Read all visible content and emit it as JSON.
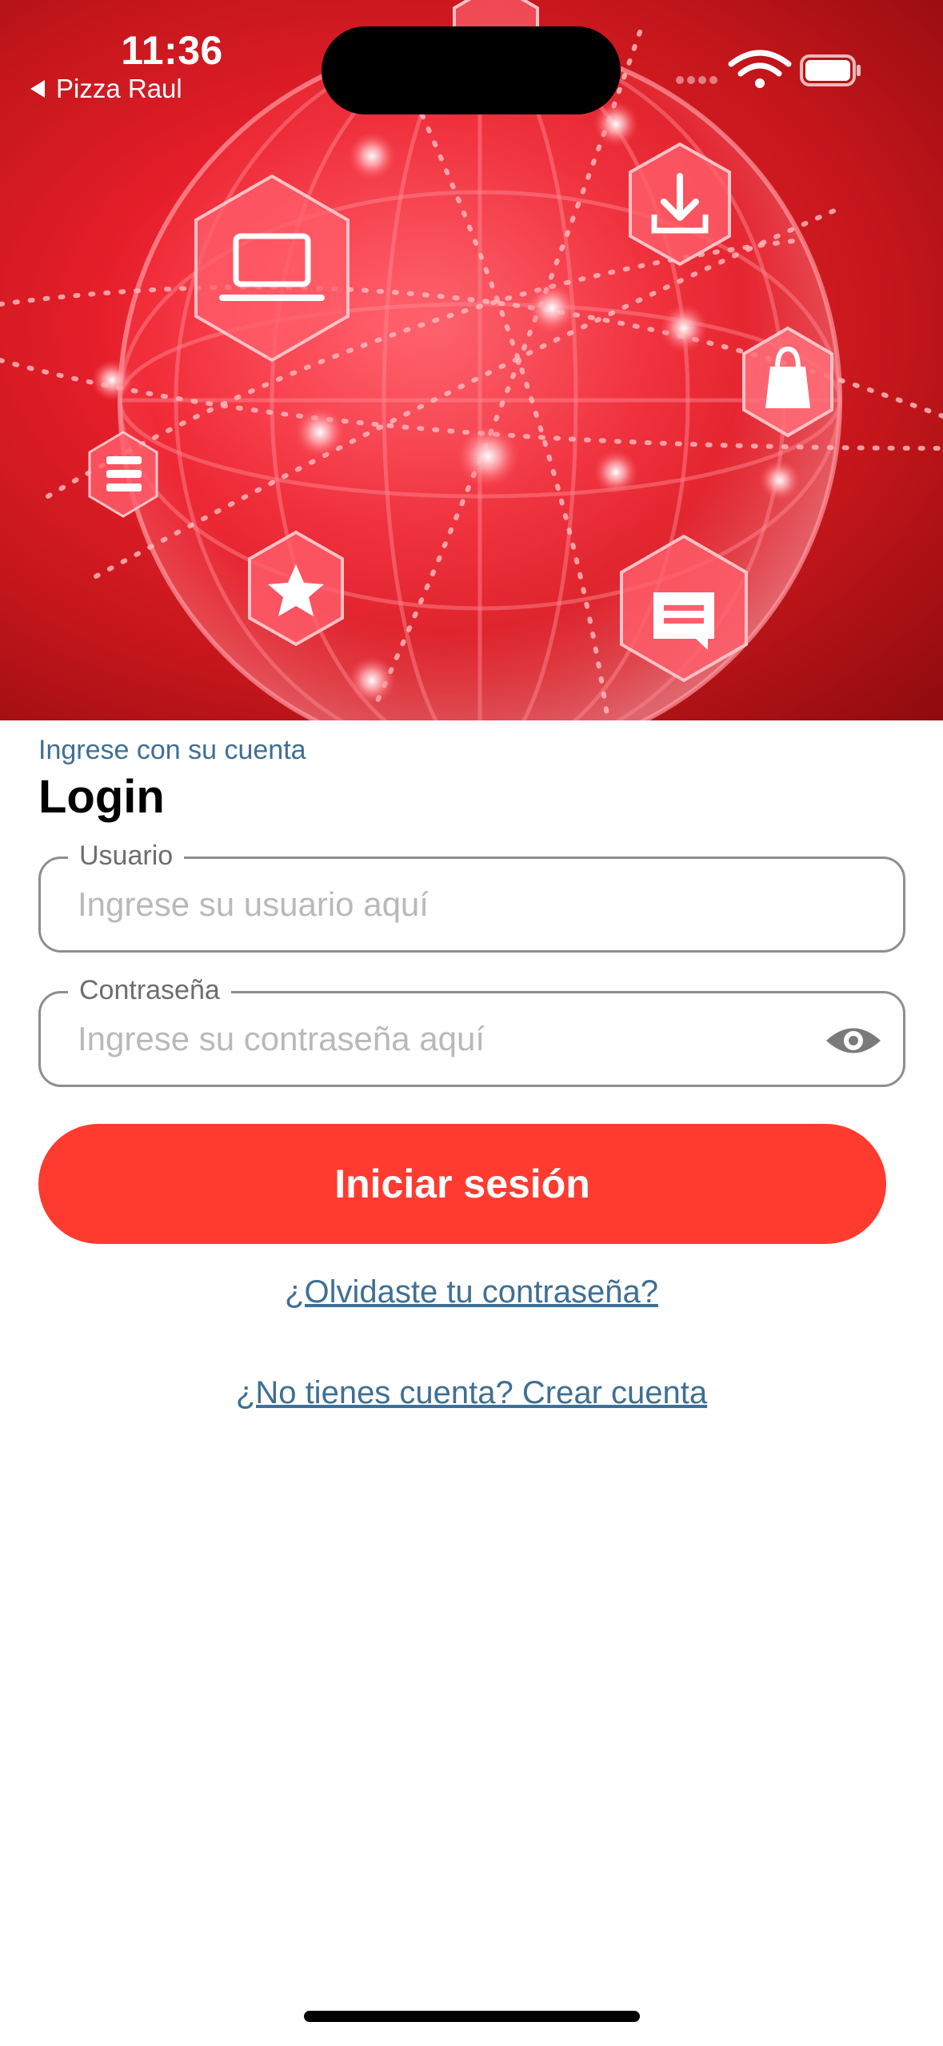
{
  "status_bar": {
    "time": "11:36",
    "back_app": "Pizza Raul",
    "icons": [
      "signal-dots-icon",
      "wifi-icon",
      "battery-icon"
    ]
  },
  "hero": {
    "icons": [
      "laptop-icon",
      "download-icon",
      "shopping-bag-icon",
      "list-icon",
      "star-icon",
      "chat-icon"
    ]
  },
  "login": {
    "subtitle": "Ingrese con su cuenta",
    "title": "Login",
    "username": {
      "label": "Usuario",
      "placeholder": "Ingrese su usuario aquí",
      "value": ""
    },
    "password": {
      "label": "Contraseña",
      "placeholder": "Ingrese su contraseña aquí",
      "value": ""
    },
    "submit_label": "Iniciar sesión",
    "forgot_link": "¿Olvidaste tu contraseña?",
    "signup_link": "¿No tienes cuenta? Crear cuenta"
  },
  "colors": {
    "accent": "#ff3b30",
    "link": "#3f6f94",
    "hero_red": "#d9141c"
  }
}
